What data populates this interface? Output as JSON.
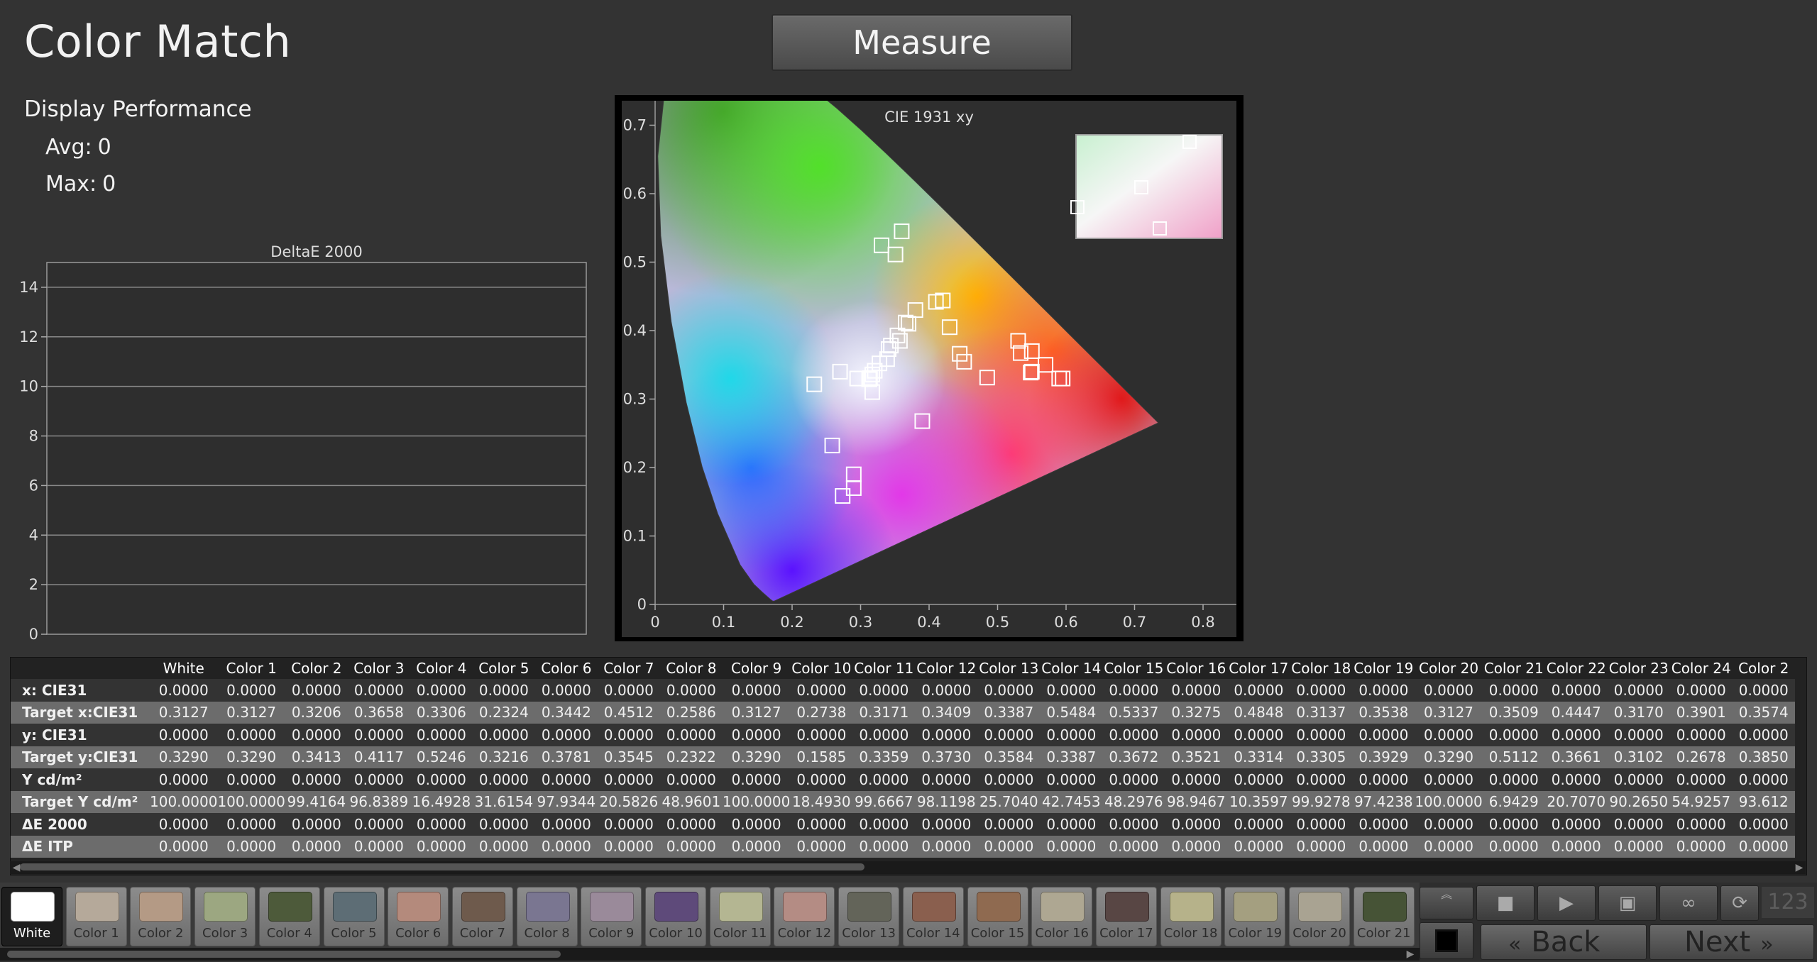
{
  "app": {
    "title": "Color Match",
    "measure_label": "Measure"
  },
  "performance": {
    "heading": "Display Performance",
    "avg_label": "Avg:",
    "avg_value": "0",
    "max_label": "Max:",
    "max_value": "0"
  },
  "chart_data": [
    {
      "type": "bar",
      "title": "DeltaE 2000",
      "xlabel": "",
      "ylabel": "",
      "ylim": [
        0,
        15
      ],
      "yticks": [
        "0",
        "2",
        "4",
        "6",
        "8",
        "10",
        "12",
        "14"
      ],
      "categories": [],
      "values": [],
      "grid": true
    },
    {
      "type": "scatter",
      "title": "CIE 1931 xy",
      "xlabel": "",
      "ylabel": "",
      "xlim": [
        0,
        0.85
      ],
      "ylim": [
        0,
        0.85
      ],
      "xticks": [
        "0",
        "0.1",
        "0.2",
        "0.3",
        "0.4",
        "0.5",
        "0.6",
        "0.7",
        "0.8"
      ],
      "yticks": [
        "0",
        "0.1",
        "0.2",
        "0.3",
        "0.4",
        "0.5",
        "0.6",
        "0.7",
        "0.8"
      ],
      "series": [
        {
          "points": [
            [
              0.3127,
              0.329
            ],
            [
              0.3127,
              0.329
            ],
            [
              0.3206,
              0.3413
            ],
            [
              0.3658,
              0.4117
            ],
            [
              0.3306,
              0.5246
            ],
            [
              0.2324,
              0.3216
            ],
            [
              0.3442,
              0.3781
            ],
            [
              0.4512,
              0.3545
            ],
            [
              0.2586,
              0.2322
            ],
            [
              0.3127,
              0.329
            ],
            [
              0.2738,
              0.1585
            ],
            [
              0.3171,
              0.3359
            ],
            [
              0.3409,
              0.373
            ],
            [
              0.3387,
              0.3584
            ],
            [
              0.5484,
              0.3387
            ],
            [
              0.5337,
              0.3672
            ],
            [
              0.3275,
              0.3521
            ],
            [
              0.4848,
              0.3314
            ],
            [
              0.3137,
              0.3305
            ],
            [
              0.3538,
              0.3929
            ],
            [
              0.3127,
              0.329
            ],
            [
              0.3509,
              0.5112
            ],
            [
              0.4447,
              0.3661
            ],
            [
              0.317,
              0.3102
            ],
            [
              0.3901,
              0.2678
            ],
            [
              0.3574,
              0.385
            ],
            [
              0.41,
              0.442
            ],
            [
              0.42,
              0.444
            ],
            [
              0.36,
              0.545
            ],
            [
              0.29,
              0.19
            ],
            [
              0.27,
              0.34
            ],
            [
              0.53,
              0.385
            ],
            [
              0.55,
              0.37
            ],
            [
              0.57,
              0.35
            ],
            [
              0.59,
              0.33
            ],
            [
              0.595,
              0.33
            ],
            [
              0.29,
              0.17
            ],
            [
              0.38,
              0.43
            ],
            [
              0.37,
              0.41
            ],
            [
              0.295,
              0.33
            ],
            [
              0.55,
              0.34
            ],
            [
              0.43,
              0.405
            ]
          ]
        }
      ]
    }
  ],
  "table": {
    "columns": [
      "White",
      "Color 1",
      "Color 2",
      "Color 3",
      "Color 4",
      "Color 5",
      "Color 6",
      "Color 7",
      "Color 8",
      "Color 9",
      "Color 10",
      "Color 11",
      "Color 12",
      "Color 13",
      "Color 14",
      "Color 15",
      "Color 16",
      "Color 17",
      "Color 18",
      "Color 19",
      "Color 20",
      "Color 21",
      "Color 22",
      "Color 23",
      "Color 24",
      "Color 2"
    ],
    "rows": [
      {
        "label": "x: CIE31",
        "values": [
          "0.0000",
          "0.0000",
          "0.0000",
          "0.0000",
          "0.0000",
          "0.0000",
          "0.0000",
          "0.0000",
          "0.0000",
          "0.0000",
          "0.0000",
          "0.0000",
          "0.0000",
          "0.0000",
          "0.0000",
          "0.0000",
          "0.0000",
          "0.0000",
          "0.0000",
          "0.0000",
          "0.0000",
          "0.0000",
          "0.0000",
          "0.0000",
          "0.0000",
          "0.0000"
        ]
      },
      {
        "label": "Target x:CIE31",
        "values": [
          "0.3127",
          "0.3127",
          "0.3206",
          "0.3658",
          "0.3306",
          "0.2324",
          "0.3442",
          "0.4512",
          "0.2586",
          "0.3127",
          "0.2738",
          "0.3171",
          "0.3409",
          "0.3387",
          "0.5484",
          "0.5337",
          "0.3275",
          "0.4848",
          "0.3137",
          "0.3538",
          "0.3127",
          "0.3509",
          "0.4447",
          "0.3170",
          "0.3901",
          "0.3574"
        ]
      },
      {
        "label": "y: CIE31",
        "values": [
          "0.0000",
          "0.0000",
          "0.0000",
          "0.0000",
          "0.0000",
          "0.0000",
          "0.0000",
          "0.0000",
          "0.0000",
          "0.0000",
          "0.0000",
          "0.0000",
          "0.0000",
          "0.0000",
          "0.0000",
          "0.0000",
          "0.0000",
          "0.0000",
          "0.0000",
          "0.0000",
          "0.0000",
          "0.0000",
          "0.0000",
          "0.0000",
          "0.0000",
          "0.0000"
        ]
      },
      {
        "label": "Target y:CIE31",
        "values": [
          "0.3290",
          "0.3290",
          "0.3413",
          "0.4117",
          "0.5246",
          "0.3216",
          "0.3781",
          "0.3545",
          "0.2322",
          "0.3290",
          "0.1585",
          "0.3359",
          "0.3730",
          "0.3584",
          "0.3387",
          "0.3672",
          "0.3521",
          "0.3314",
          "0.3305",
          "0.3929",
          "0.3290",
          "0.5112",
          "0.3661",
          "0.3102",
          "0.2678",
          "0.3850"
        ]
      },
      {
        "label": "Y cd/m²",
        "values": [
          "0.0000",
          "0.0000",
          "0.0000",
          "0.0000",
          "0.0000",
          "0.0000",
          "0.0000",
          "0.0000",
          "0.0000",
          "0.0000",
          "0.0000",
          "0.0000",
          "0.0000",
          "0.0000",
          "0.0000",
          "0.0000",
          "0.0000",
          "0.0000",
          "0.0000",
          "0.0000",
          "0.0000",
          "0.0000",
          "0.0000",
          "0.0000",
          "0.0000",
          "0.0000"
        ]
      },
      {
        "label": "Target Y cd/m²",
        "values": [
          "100.0000",
          "100.0000",
          "99.4164",
          "96.8389",
          "16.4928",
          "31.6154",
          "97.9344",
          "20.5826",
          "48.9601",
          "100.0000",
          "18.4930",
          "99.6667",
          "98.1198",
          "25.7040",
          "42.7453",
          "48.2976",
          "98.9467",
          "10.3597",
          "99.9278",
          "97.4238",
          "100.0000",
          "6.9429",
          "20.7070",
          "90.2650",
          "54.9257",
          "93.612"
        ]
      },
      {
        "label": "ΔE 2000",
        "values": [
          "0.0000",
          "0.0000",
          "0.0000",
          "0.0000",
          "0.0000",
          "0.0000",
          "0.0000",
          "0.0000",
          "0.0000",
          "0.0000",
          "0.0000",
          "0.0000",
          "0.0000",
          "0.0000",
          "0.0000",
          "0.0000",
          "0.0000",
          "0.0000",
          "0.0000",
          "0.0000",
          "0.0000",
          "0.0000",
          "0.0000",
          "0.0000",
          "0.0000",
          "0.0000"
        ]
      },
      {
        "label": "ΔE ITP",
        "values": [
          "0.0000",
          "0.0000",
          "0.0000",
          "0.0000",
          "0.0000",
          "0.0000",
          "0.0000",
          "0.0000",
          "0.0000",
          "0.0000",
          "0.0000",
          "0.0000",
          "0.0000",
          "0.0000",
          "0.0000",
          "0.0000",
          "0.0000",
          "0.0000",
          "0.0000",
          "0.0000",
          "0.0000",
          "0.0000",
          "0.0000",
          "0.0000",
          "0.0000",
          "0.0000"
        ]
      }
    ]
  },
  "swatches": [
    {
      "label": "White",
      "color": "#ffffff",
      "active": true
    },
    {
      "label": "Color 1",
      "color": "#b5a99a"
    },
    {
      "label": "Color 2",
      "color": "#b49a85"
    },
    {
      "label": "Color 3",
      "color": "#9ca781"
    },
    {
      "label": "Color 4",
      "color": "#4d5a3a"
    },
    {
      "label": "Color 5",
      "color": "#5d6d75"
    },
    {
      "label": "Color 6",
      "color": "#b48a7c"
    },
    {
      "label": "Color 7",
      "color": "#6e5a4c"
    },
    {
      "label": "Color 8",
      "color": "#7a7691"
    },
    {
      "label": "Color 9",
      "color": "#9a8a9a"
    },
    {
      "label": "Color 10",
      "color": "#5e4a7a"
    },
    {
      "label": "Color 11",
      "color": "#b4b692"
    },
    {
      "label": "Color 12",
      "color": "#b48c84"
    },
    {
      "label": "Color 13",
      "color": "#636459"
    },
    {
      "label": "Color 14",
      "color": "#8a5f4e"
    },
    {
      "label": "Color 15",
      "color": "#8f6a50"
    },
    {
      "label": "Color 16",
      "color": "#aea792"
    },
    {
      "label": "Color 17",
      "color": "#584644"
    },
    {
      "label": "Color 18",
      "color": "#b6b28a"
    },
    {
      "label": "Color 19",
      "color": "#a49f80"
    },
    {
      "label": "Color 20",
      "color": "#a9a392"
    },
    {
      "label": "Color 21",
      "color": "#465336"
    }
  ],
  "controls": {
    "back_label": "Back",
    "next_label": "Next",
    "counter": "123",
    "buttons": [
      "stop-icon",
      "play-icon",
      "save-icon",
      "loop-icon",
      "refresh-icon"
    ]
  }
}
